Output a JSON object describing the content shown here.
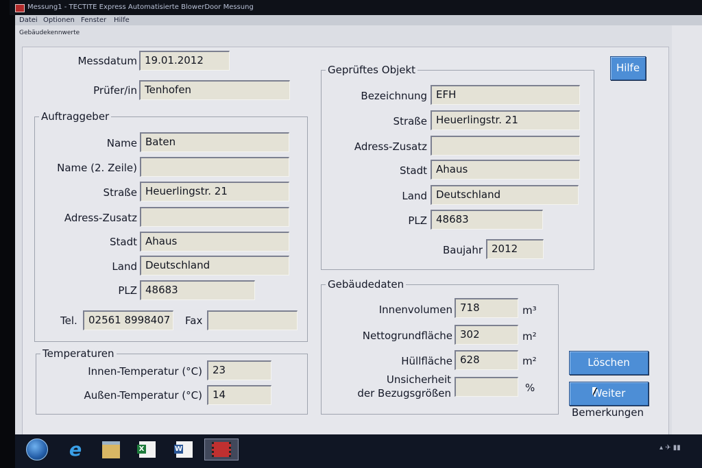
{
  "window": {
    "title": "Messung1 - TECTITE Express Automatisierte BlowerDoor Messung"
  },
  "menu": [
    "Datei",
    "Optionen",
    "Fenster",
    "Hilfe"
  ],
  "dialog": {
    "title": "Gebäudekennwerte"
  },
  "general": {
    "messdatum_label": "Messdatum",
    "messdatum_value": "19.01.2012",
    "pruefer_label": "Prüfer/in",
    "pruefer_value": "Tenhofen"
  },
  "auftraggeber": {
    "title": "Auftraggeber",
    "name_label": "Name",
    "name_value": "Baten",
    "name2_label": "Name (2. Zeile)",
    "name2_value": "",
    "strasse_label": "Straße",
    "strasse_value": "Heuerlingstr. 21",
    "adresszusatz_label": "Adress-Zusatz",
    "adresszusatz_value": "",
    "stadt_label": "Stadt",
    "stadt_value": "Ahaus",
    "land_label": "Land",
    "land_value": "Deutschland",
    "plz_label": "PLZ",
    "plz_value": "48683",
    "tel_label": "Tel.",
    "tel_value": "02561 8998407",
    "fax_label": "Fax",
    "fax_value": ""
  },
  "temperaturen": {
    "title": "Temperaturen",
    "innen_label": "Innen-Temperatur (°C)",
    "innen_value": "23",
    "aussen_label": "Außen-Temperatur (°C)",
    "aussen_value": "14"
  },
  "objekt": {
    "title": "Geprüftes Objekt",
    "bezeichnung_label": "Bezeichnung",
    "bezeichnung_value": "EFH",
    "strasse_label": "Straße",
    "strasse_value": "Heuerlingstr. 21",
    "adresszusatz_label": "Adress-Zusatz",
    "adresszusatz_value": "",
    "stadt_label": "Stadt",
    "stadt_value": "Ahaus",
    "land_label": "Land",
    "land_value": "Deutschland",
    "plz_label": "PLZ",
    "plz_value": "48683",
    "baujahr_label": "Baujahr",
    "baujahr_value": "2012"
  },
  "gebaeudedaten": {
    "title": "Gebäudedaten",
    "innenvolumen_label": "Innenvolumen",
    "innenvolumen_value": "718",
    "innenvolumen_unit": "m³",
    "netto_label": "Nettogrundfläche",
    "netto_value": "302",
    "netto_unit": "m²",
    "huell_label": "Hüllfläche",
    "huell_value": "628",
    "huell_unit": "m²",
    "unsicherheit_label1": "Unsicherheit",
    "unsicherheit_label2": "der Bezugsgrößen",
    "unsicherheit_value": "",
    "unsicherheit_unit": "%"
  },
  "buttons": {
    "hilfe": "Hilfe",
    "loeschen": "Löschen",
    "weiter": "Weiter",
    "bemerkungen": "Bemerkungen"
  },
  "colors": {
    "button_blue": "#4d8ed6",
    "field_bg": "#e4e2d6",
    "panel_bg": "#e6e7ec"
  }
}
